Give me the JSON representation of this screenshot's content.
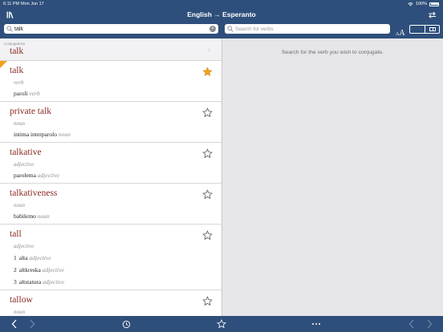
{
  "status_bar": {
    "time": "6:11 PM",
    "date": "Mon Jun 17",
    "battery": "100%"
  },
  "nav": {
    "title": "English → Esperanto"
  },
  "search": {
    "query": "talk"
  },
  "verb_search": {
    "placeholder": "Search for verbs"
  },
  "font_size_icon": {
    "small": "A",
    "large": "A"
  },
  "conjugations": {
    "label": "Conjugations",
    "word": "talk"
  },
  "entries": [
    {
      "headword": "talk",
      "pos": "verb",
      "starred": true,
      "translations": [
        {
          "num": "",
          "text": "paroli",
          "pos": "verb"
        }
      ]
    },
    {
      "headword": "private talk",
      "pos": "noun",
      "starred": false,
      "translations": [
        {
          "num": "",
          "text": "intima interparolo",
          "pos": "noun"
        }
      ]
    },
    {
      "headword": "talkative",
      "pos": "adjective",
      "starred": false,
      "translations": [
        {
          "num": "",
          "text": "parolema",
          "pos": "adjective"
        }
      ]
    },
    {
      "headword": "talkativeness",
      "pos": "noun",
      "starred": false,
      "translations": [
        {
          "num": "",
          "text": "babilemo",
          "pos": "noun"
        }
      ]
    },
    {
      "headword": "tall",
      "pos": "adjective",
      "starred": false,
      "translations": [
        {
          "num": "1",
          "text": "alta",
          "pos": "adjective"
        },
        {
          "num": "2",
          "text": "altkreska",
          "pos": "adjective"
        },
        {
          "num": "3",
          "text": "altstatura",
          "pos": "adjective"
        }
      ]
    },
    {
      "headword": "tallow",
      "pos": "noun",
      "starred": false,
      "translations": []
    }
  ],
  "right_pane": {
    "hint": "Search for the verb you wish to conjugate."
  },
  "colors": {
    "nav_bar": "#2e4f7b",
    "headword": "#8b2a22",
    "star_active": "#f0a020",
    "right_pane_bg": "#e6e6e9"
  }
}
